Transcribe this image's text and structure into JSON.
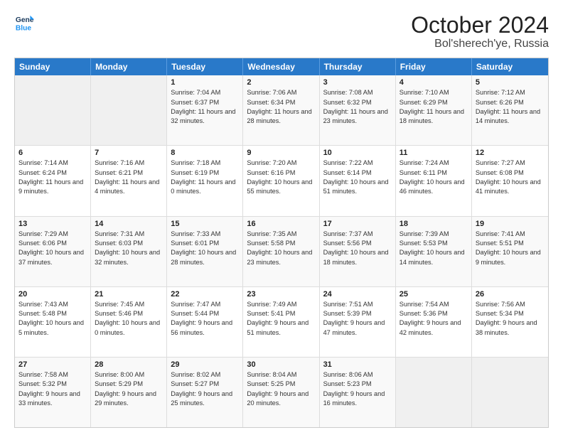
{
  "header": {
    "logo_line1": "General",
    "logo_line2": "Blue",
    "title": "October 2024",
    "subtitle": "Bol'sherech'ye, Russia"
  },
  "weekdays": [
    "Sunday",
    "Monday",
    "Tuesday",
    "Wednesday",
    "Thursday",
    "Friday",
    "Saturday"
  ],
  "rows": [
    [
      {
        "day": "",
        "sunrise": "",
        "sunset": "",
        "daylight": "",
        "shaded": true
      },
      {
        "day": "",
        "sunrise": "",
        "sunset": "",
        "daylight": "",
        "shaded": true
      },
      {
        "day": "1",
        "sunrise": "Sunrise: 7:04 AM",
        "sunset": "Sunset: 6:37 PM",
        "daylight": "Daylight: 11 hours and 32 minutes."
      },
      {
        "day": "2",
        "sunrise": "Sunrise: 7:06 AM",
        "sunset": "Sunset: 6:34 PM",
        "daylight": "Daylight: 11 hours and 28 minutes."
      },
      {
        "day": "3",
        "sunrise": "Sunrise: 7:08 AM",
        "sunset": "Sunset: 6:32 PM",
        "daylight": "Daylight: 11 hours and 23 minutes."
      },
      {
        "day": "4",
        "sunrise": "Sunrise: 7:10 AM",
        "sunset": "Sunset: 6:29 PM",
        "daylight": "Daylight: 11 hours and 18 minutes."
      },
      {
        "day": "5",
        "sunrise": "Sunrise: 7:12 AM",
        "sunset": "Sunset: 6:26 PM",
        "daylight": "Daylight: 11 hours and 14 minutes."
      }
    ],
    [
      {
        "day": "6",
        "sunrise": "Sunrise: 7:14 AM",
        "sunset": "Sunset: 6:24 PM",
        "daylight": "Daylight: 11 hours and 9 minutes."
      },
      {
        "day": "7",
        "sunrise": "Sunrise: 7:16 AM",
        "sunset": "Sunset: 6:21 PM",
        "daylight": "Daylight: 11 hours and 4 minutes."
      },
      {
        "day": "8",
        "sunrise": "Sunrise: 7:18 AM",
        "sunset": "Sunset: 6:19 PM",
        "daylight": "Daylight: 11 hours and 0 minutes."
      },
      {
        "day": "9",
        "sunrise": "Sunrise: 7:20 AM",
        "sunset": "Sunset: 6:16 PM",
        "daylight": "Daylight: 10 hours and 55 minutes."
      },
      {
        "day": "10",
        "sunrise": "Sunrise: 7:22 AM",
        "sunset": "Sunset: 6:14 PM",
        "daylight": "Daylight: 10 hours and 51 minutes."
      },
      {
        "day": "11",
        "sunrise": "Sunrise: 7:24 AM",
        "sunset": "Sunset: 6:11 PM",
        "daylight": "Daylight: 10 hours and 46 minutes."
      },
      {
        "day": "12",
        "sunrise": "Sunrise: 7:27 AM",
        "sunset": "Sunset: 6:08 PM",
        "daylight": "Daylight: 10 hours and 41 minutes."
      }
    ],
    [
      {
        "day": "13",
        "sunrise": "Sunrise: 7:29 AM",
        "sunset": "Sunset: 6:06 PM",
        "daylight": "Daylight: 10 hours and 37 minutes."
      },
      {
        "day": "14",
        "sunrise": "Sunrise: 7:31 AM",
        "sunset": "Sunset: 6:03 PM",
        "daylight": "Daylight: 10 hours and 32 minutes."
      },
      {
        "day": "15",
        "sunrise": "Sunrise: 7:33 AM",
        "sunset": "Sunset: 6:01 PM",
        "daylight": "Daylight: 10 hours and 28 minutes."
      },
      {
        "day": "16",
        "sunrise": "Sunrise: 7:35 AM",
        "sunset": "Sunset: 5:58 PM",
        "daylight": "Daylight: 10 hours and 23 minutes."
      },
      {
        "day": "17",
        "sunrise": "Sunrise: 7:37 AM",
        "sunset": "Sunset: 5:56 PM",
        "daylight": "Daylight: 10 hours and 18 minutes."
      },
      {
        "day": "18",
        "sunrise": "Sunrise: 7:39 AM",
        "sunset": "Sunset: 5:53 PM",
        "daylight": "Daylight: 10 hours and 14 minutes."
      },
      {
        "day": "19",
        "sunrise": "Sunrise: 7:41 AM",
        "sunset": "Sunset: 5:51 PM",
        "daylight": "Daylight: 10 hours and 9 minutes."
      }
    ],
    [
      {
        "day": "20",
        "sunrise": "Sunrise: 7:43 AM",
        "sunset": "Sunset: 5:48 PM",
        "daylight": "Daylight: 10 hours and 5 minutes."
      },
      {
        "day": "21",
        "sunrise": "Sunrise: 7:45 AM",
        "sunset": "Sunset: 5:46 PM",
        "daylight": "Daylight: 10 hours and 0 minutes."
      },
      {
        "day": "22",
        "sunrise": "Sunrise: 7:47 AM",
        "sunset": "Sunset: 5:44 PM",
        "daylight": "Daylight: 9 hours and 56 minutes."
      },
      {
        "day": "23",
        "sunrise": "Sunrise: 7:49 AM",
        "sunset": "Sunset: 5:41 PM",
        "daylight": "Daylight: 9 hours and 51 minutes."
      },
      {
        "day": "24",
        "sunrise": "Sunrise: 7:51 AM",
        "sunset": "Sunset: 5:39 PM",
        "daylight": "Daylight: 9 hours and 47 minutes."
      },
      {
        "day": "25",
        "sunrise": "Sunrise: 7:54 AM",
        "sunset": "Sunset: 5:36 PM",
        "daylight": "Daylight: 9 hours and 42 minutes."
      },
      {
        "day": "26",
        "sunrise": "Sunrise: 7:56 AM",
        "sunset": "Sunset: 5:34 PM",
        "daylight": "Daylight: 9 hours and 38 minutes."
      }
    ],
    [
      {
        "day": "27",
        "sunrise": "Sunrise: 7:58 AM",
        "sunset": "Sunset: 5:32 PM",
        "daylight": "Daylight: 9 hours and 33 minutes."
      },
      {
        "day": "28",
        "sunrise": "Sunrise: 8:00 AM",
        "sunset": "Sunset: 5:29 PM",
        "daylight": "Daylight: 9 hours and 29 minutes."
      },
      {
        "day": "29",
        "sunrise": "Sunrise: 8:02 AM",
        "sunset": "Sunset: 5:27 PM",
        "daylight": "Daylight: 9 hours and 25 minutes."
      },
      {
        "day": "30",
        "sunrise": "Sunrise: 8:04 AM",
        "sunset": "Sunset: 5:25 PM",
        "daylight": "Daylight: 9 hours and 20 minutes."
      },
      {
        "day": "31",
        "sunrise": "Sunrise: 8:06 AM",
        "sunset": "Sunset: 5:23 PM",
        "daylight": "Daylight: 9 hours and 16 minutes."
      },
      {
        "day": "",
        "sunrise": "",
        "sunset": "",
        "daylight": "",
        "shaded": true
      },
      {
        "day": "",
        "sunrise": "",
        "sunset": "",
        "daylight": "",
        "shaded": true
      }
    ]
  ]
}
